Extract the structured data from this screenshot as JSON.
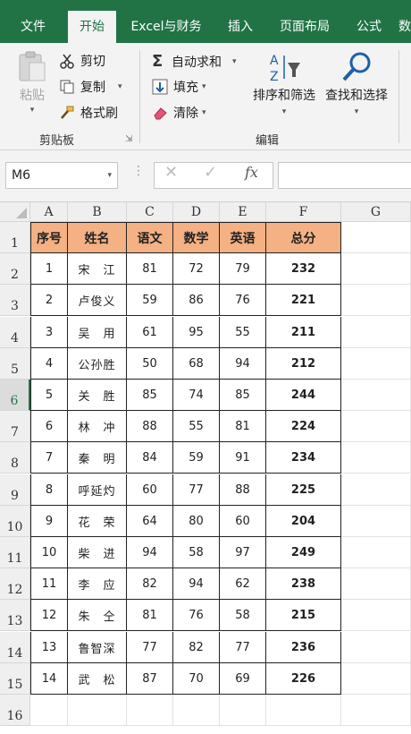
{
  "tabs": [
    "文件",
    "开始",
    "Excel与财务",
    "插入",
    "页面布局",
    "公式",
    "数"
  ],
  "active_tab": "开始",
  "ribbon": {
    "clipboard": {
      "paste": "粘贴",
      "cut": "剪切",
      "copy": "复制",
      "format_painter": "格式刷",
      "group_label": "剪贴板"
    },
    "editing": {
      "autosum": "自动求和",
      "fill": "填充",
      "clear": "清除",
      "sort_filter": "排序和筛选",
      "find_select": "查找和选择",
      "group_label": "编辑"
    }
  },
  "formula_bar": {
    "name_box": "M6",
    "fx": "fx",
    "value": ""
  },
  "columns": [
    "A",
    "B",
    "C",
    "D",
    "E",
    "F",
    "G"
  ],
  "row_numbers": [
    "1",
    "2",
    "3",
    "4",
    "5",
    "6",
    "7",
    "8",
    "9",
    "10",
    "11",
    "12",
    "13",
    "14",
    "15",
    "16"
  ],
  "active_row": "6",
  "table": {
    "headers": [
      "序号",
      "姓名",
      "语文",
      "数学",
      "英语",
      "总分"
    ],
    "rows": [
      [
        "1",
        "宋　江",
        "81",
        "72",
        "79",
        "232"
      ],
      [
        "2",
        "卢俊义",
        "59",
        "86",
        "76",
        "221"
      ],
      [
        "3",
        "吴　用",
        "61",
        "95",
        "55",
        "211"
      ],
      [
        "4",
        "公孙胜",
        "50",
        "68",
        "94",
        "212"
      ],
      [
        "5",
        "关　胜",
        "85",
        "74",
        "85",
        "244"
      ],
      [
        "6",
        "林　冲",
        "88",
        "55",
        "81",
        "224"
      ],
      [
        "7",
        "秦　明",
        "84",
        "59",
        "91",
        "234"
      ],
      [
        "8",
        "呼延灼",
        "60",
        "77",
        "88",
        "225"
      ],
      [
        "9",
        "花　荣",
        "64",
        "80",
        "60",
        "204"
      ],
      [
        "10",
        "柴　进",
        "94",
        "58",
        "97",
        "249"
      ],
      [
        "11",
        "李　应",
        "82",
        "94",
        "62",
        "238"
      ],
      [
        "12",
        "朱　仝",
        "81",
        "76",
        "58",
        "215"
      ],
      [
        "13",
        "鲁智深",
        "77",
        "82",
        "77",
        "236"
      ],
      [
        "14",
        "武　松",
        "87",
        "70",
        "69",
        "226"
      ]
    ]
  },
  "colors": {
    "brand": "#217346",
    "header_fill": "#f4b183"
  }
}
